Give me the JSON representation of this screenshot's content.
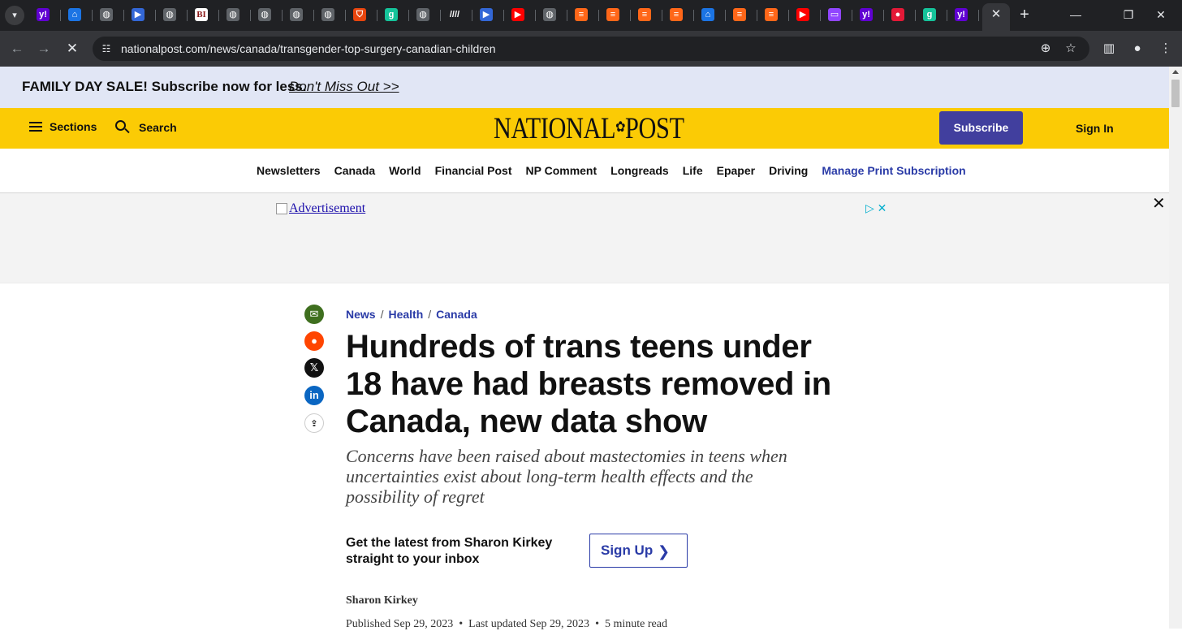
{
  "browser": {
    "tabs": [
      {
        "icon": "yahoo-icon",
        "glyph": "y!",
        "color": "#6001d2"
      },
      {
        "icon": "leaf-icon",
        "glyph": "⌂",
        "color": "#1b74e4"
      },
      {
        "icon": "globe-icon",
        "glyph": "◍",
        "color": "#5f6368"
      },
      {
        "icon": "media-icon",
        "glyph": "▶",
        "color": "#3367d6"
      },
      {
        "icon": "globe-icon",
        "glyph": "◍",
        "color": "#5f6368"
      },
      {
        "icon": "bi-icon",
        "glyph": "BI",
        "color": "#ffffff"
      },
      {
        "icon": "globe-icon",
        "glyph": "◍",
        "color": "#5f6368"
      },
      {
        "icon": "globe-icon",
        "glyph": "◍",
        "color": "#5f6368"
      },
      {
        "icon": "globe-icon",
        "glyph": "◍",
        "color": "#5f6368"
      },
      {
        "icon": "globe-icon",
        "glyph": "◍",
        "color": "#5f6368"
      },
      {
        "icon": "shield-icon",
        "glyph": "⛉",
        "color": "#e8450e"
      },
      {
        "icon": "grammarly-icon",
        "glyph": "g",
        "color": "#15c39a"
      },
      {
        "icon": "globe-icon",
        "glyph": "◍",
        "color": "#5f6368"
      },
      {
        "icon": "substack-icon",
        "glyph": "////",
        "color": "#202124"
      },
      {
        "icon": "media-icon",
        "glyph": "▶",
        "color": "#3367d6"
      },
      {
        "icon": "youtube-icon",
        "glyph": "▶",
        "color": "#ff0000"
      },
      {
        "icon": "globe-icon",
        "glyph": "◍",
        "color": "#5f6368"
      },
      {
        "icon": "bookmark-icon",
        "glyph": "≡",
        "color": "#ff6719"
      },
      {
        "icon": "bookmark-icon",
        "glyph": "≡",
        "color": "#ff6719"
      },
      {
        "icon": "bookmark-icon",
        "glyph": "≡",
        "color": "#ff6719"
      },
      {
        "icon": "bookmark-icon",
        "glyph": "≡",
        "color": "#ff6719"
      },
      {
        "icon": "leaf-icon",
        "glyph": "⌂",
        "color": "#1b74e4"
      },
      {
        "icon": "bookmark-icon",
        "glyph": "≡",
        "color": "#ff6719"
      },
      {
        "icon": "bookmark-icon",
        "glyph": "≡",
        "color": "#ff6719"
      },
      {
        "icon": "youtube-icon",
        "glyph": "▶",
        "color": "#ff0000"
      },
      {
        "icon": "twitch-icon",
        "glyph": "▭",
        "color": "#9146ff"
      },
      {
        "icon": "yahoo-icon",
        "glyph": "y!",
        "color": "#6001d2"
      },
      {
        "icon": "mic-icon",
        "glyph": "●",
        "color": "#e41937"
      },
      {
        "icon": "grammarly-icon",
        "glyph": "g",
        "color": "#15c39a"
      },
      {
        "icon": "yahoo-icon",
        "glyph": "y!",
        "color": "#6001d2"
      }
    ],
    "url": "nationalpost.com/news/canada/transgender-top-surgery-canadian-children"
  },
  "promo": {
    "text": "FAMILY DAY SALE! Subscribe now for less.",
    "link": "Don't Miss Out >>"
  },
  "header": {
    "sections_label": "Sections",
    "search_label": "Search",
    "logo_left": "NATIONAL",
    "logo_right": "POST",
    "subscribe_label": "Subscribe",
    "signin_label": "Sign In",
    "brand_color": "#fbcb05",
    "subscribe_color": "#413f9e"
  },
  "secnav": {
    "items": [
      "Newsletters",
      "Canada",
      "World",
      "Financial Post",
      "NP Comment",
      "Longreads",
      "Life",
      "Epaper",
      "Driving",
      "Manage Print Subscription"
    ]
  },
  "ad": {
    "alt_text": "Advertisement"
  },
  "share": [
    {
      "icon": "email-icon",
      "glyph": "✉",
      "color": "#3f6f1f"
    },
    {
      "icon": "reddit-icon",
      "glyph": "●",
      "color": "#ff4500"
    },
    {
      "icon": "x-icon",
      "glyph": "𝕏",
      "color": "#111111"
    },
    {
      "icon": "linkedin-icon",
      "glyph": "in",
      "color": "#0a66c2"
    },
    {
      "icon": "share-icon",
      "glyph": "⇪",
      "color": "#ffffff"
    }
  ],
  "article": {
    "breadcrumb": [
      "News",
      "Health",
      "Canada"
    ],
    "headline": "Hundreds of trans teens under 18 have had breasts removed in Canada, new data show",
    "subhead": "Concerns have been raised about mastectomies in teens when uncertainties exist about long-term health effects and the possibility of regret",
    "newsletter_text": "Get the latest from Sharon Kirkey straight to your inbox",
    "signup_label": "Sign Up",
    "author": "Sharon Kirkey",
    "published": "Published Sep 29, 2023",
    "updated": "Last updated Sep 29, 2023",
    "read_time": "5 minute read",
    "link_color": "#2a3ba7"
  }
}
